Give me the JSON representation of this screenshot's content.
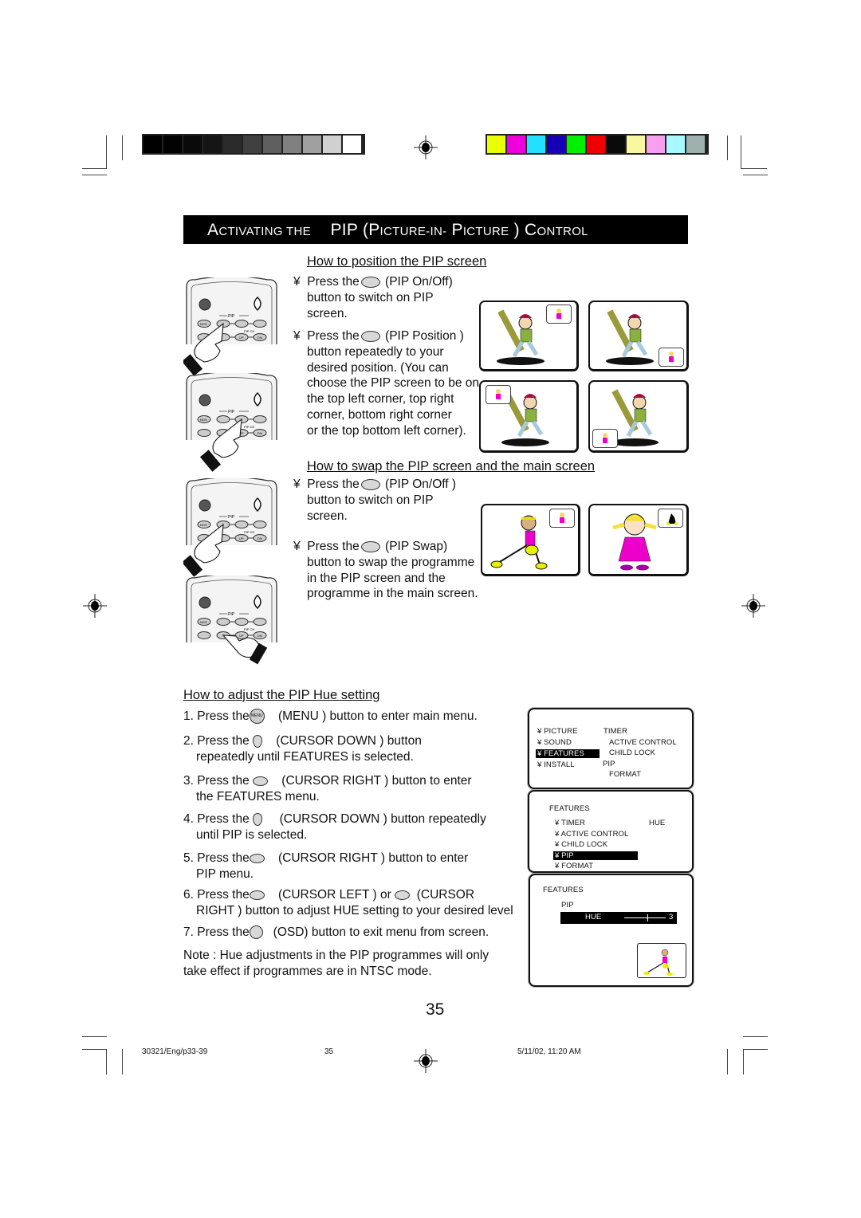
{
  "print_marks": {
    "grayscale_swatches": [
      "#000000",
      "#020202",
      "#0a0a0a",
      "#151515",
      "#2a2a2a",
      "#404040",
      "#5f5f5f",
      "#808080",
      "#a0a0a0",
      "#d0d0d0",
      "#ffffff"
    ],
    "color_swatches": [
      "#eaff00",
      "#ee00dd",
      "#22e0ff",
      "#1500b8",
      "#00f000",
      "#f00000",
      "#0a0a0a",
      "#f8f8a0",
      "#f8a0f0",
      "#a8f8ff",
      "#a0b0ac"
    ]
  },
  "title": {
    "part1_cap": "A",
    "part1_rest": "CTIVATING THE",
    "part2": "PIP (P",
    "part2_rest": "ICTURE-IN-",
    "part3_cap": "P",
    "part3_rest": "ICTURE",
    "part4": ") C",
    "part4_rest": "ONTROL"
  },
  "section_position": {
    "heading": "How to position the PIP screen",
    "step1": {
      "bullet": "¥",
      "prefix": "Press the",
      "button_name": "(PIP On/Off)",
      "lines": [
        "button to switch on PIP",
        "screen."
      ]
    },
    "step2": {
      "bullet": "¥",
      "prefix": "Press the",
      "button_name": "(PIP Position )",
      "lines": [
        "button repeatedly to your",
        "desired position. (You can",
        "choose the PIP screen to be on",
        "the top left corner, top right",
        "corner, bottom right corner",
        "or the top bottom left corner)."
      ]
    },
    "screens": [
      {
        "pip_corner": "top-right"
      },
      {
        "pip_corner": "bottom-right"
      },
      {
        "pip_corner": "top-left"
      },
      {
        "pip_corner": "bottom-left"
      }
    ]
  },
  "section_swap": {
    "heading": "How to swap the PIP screen and the main screen",
    "step1": {
      "bullet": "¥",
      "prefix": "Press the",
      "button_name": "(PIP On/Off )",
      "lines": [
        "button to switch on PIP",
        "screen."
      ]
    },
    "step2": {
      "bullet": "¥",
      "prefix": "Press the",
      "button_name": "(PIP Swap)",
      "lines": [
        "button to swap the programme",
        "in the PIP screen and the",
        "programme in the main screen."
      ]
    }
  },
  "remote": {
    "pip_label": "PIP",
    "pip_ch_label": "PIP CH",
    "ngs_label": "NGS",
    "up_label": "UP",
    "dn_label": "DN"
  },
  "section_hue": {
    "heading": "How to adjust the PIP Hue setting",
    "steps": [
      {
        "num": "1.",
        "prefix": "Press the",
        "icon": "menu-button",
        "icon_label": "MENU",
        "text": "(MENU ) button to enter main menu.",
        "cont": ""
      },
      {
        "num": "2.",
        "prefix": "Press the",
        "icon": "cursor-down-button",
        "text": "(CURSOR DOWN  ) button",
        "cont": "repeatedly until FEATURES  is selected."
      },
      {
        "num": "3.",
        "prefix": "Press the",
        "icon": "cursor-right-button",
        "text": "(CURSOR RIGHT ) button to enter",
        "cont": "the FEATURES  menu."
      },
      {
        "num": "4.",
        "prefix": "Press the",
        "icon": "cursor-down-button",
        "text": "(CURSOR DOWN  ) button repeatedly",
        "cont": "until PIP is selected."
      },
      {
        "num": "5.",
        "prefix": "Press the",
        "icon": "cursor-right-button",
        "text": "(CURSOR RIGHT ) button to enter",
        "cont": "PIP menu."
      },
      {
        "num": "6.",
        "prefix": "Press the",
        "icon": "cursor-left-button",
        "text": "(CURSOR LEFT ) or",
        "text2": "(CURSOR",
        "cont": "RIGHT ) button to adjust HUE  setting to your desired level"
      },
      {
        "num": "7.",
        "prefix": "Press the",
        "icon": "osd-button",
        "text": "(OSD) button to exit menu from screen.",
        "cont": ""
      }
    ],
    "note_line1": "Note  :  Hue adjustments in the PIP programmes will only",
    "note_line2": "take effect if programmes are in NTSC mode."
  },
  "osd_main_menu": {
    "items": [
      {
        "bullet": "¥",
        "label": "PICTURE",
        "selected": false
      },
      {
        "bullet": "¥",
        "label": "SOUND",
        "selected": false
      },
      {
        "bullet": "¥",
        "label": "FEATURES",
        "selected": true
      },
      {
        "bullet": "¥",
        "label": "INSTALL",
        "selected": false
      }
    ],
    "submenu": [
      "TIMER",
      "ACTIVE CONTROL",
      "CHILD LOCK",
      "PIP",
      "FORMAT"
    ]
  },
  "osd_features_menu": {
    "title": "FEATURES",
    "items": [
      {
        "bullet": "¥",
        "label": "TIMER",
        "selected": false
      },
      {
        "bullet": "¥",
        "label": "ACTIVE CONTROL",
        "selected": false
      },
      {
        "bullet": "¥",
        "label": "CHILD LOCK",
        "selected": false
      },
      {
        "bullet": "¥",
        "label": "PIP",
        "selected": true
      },
      {
        "bullet": "¥",
        "label": "FORMAT",
        "selected": false
      }
    ],
    "submenu": [
      "HUE"
    ]
  },
  "osd_pip_menu": {
    "title": "FEATURES",
    "subtitle": "PIP",
    "hue_label": "HUE",
    "hue_value": "3",
    "hue_slider_fraction": 0.55
  },
  "page_number": "35",
  "footer": {
    "file": "30321/Eng/p33-39",
    "page": "35",
    "timestamp": "5/11/02, 11:20 AM"
  }
}
